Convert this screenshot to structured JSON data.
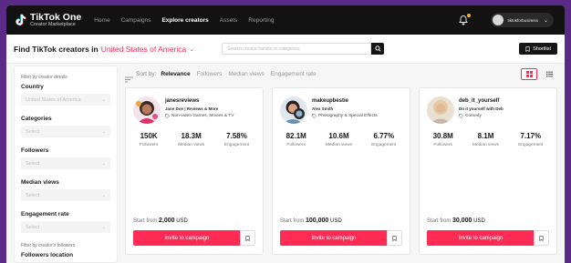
{
  "nav": {
    "brand_title": "TikTok One",
    "brand_subtitle": "Creator Marketplace",
    "items": [
      {
        "label": "Home",
        "active": false
      },
      {
        "label": "Campaigns",
        "active": false
      },
      {
        "label": "Explore creators",
        "active": true
      },
      {
        "label": "Assets",
        "active": false
      },
      {
        "label": "Reporting",
        "active": false
      }
    ],
    "account_name": "tiktokforbusiness"
  },
  "header": {
    "title": "Find TikTok creators in",
    "country": "United States of America",
    "search_placeholder": "Search creator handle or categories",
    "shortlist_label": "Shortlist"
  },
  "filters": {
    "heading": "Filter by creator details",
    "groups": [
      {
        "label": "Country",
        "value": "United States of America"
      },
      {
        "label": "Categories",
        "value": "Select"
      },
      {
        "label": "Followers",
        "value": "Select"
      },
      {
        "label": "Median views",
        "value": "Select"
      },
      {
        "label": "Engagement rate",
        "value": "Select"
      }
    ],
    "followers_heading": "Filter by creator's followers",
    "followers_location": "Followers location"
  },
  "sort": {
    "label": "Sort by:",
    "options": [
      {
        "label": "Relevance",
        "active": true
      },
      {
        "label": "Followers",
        "active": false
      },
      {
        "label": "Median views",
        "active": false
      },
      {
        "label": "Engagement rate",
        "active": false
      }
    ]
  },
  "creators": [
    {
      "handle": "janesreviews",
      "name": "Jane Doe | Reviews & More",
      "category": "Non-video Games, Movies & TV",
      "followers": "150K",
      "median_views": "18.3M",
      "engagement": "7.58%",
      "price": "2,000",
      "currency": "USD"
    },
    {
      "handle": "makeupbestie",
      "name": "Alex Smith",
      "category": "Photography & Special Effects",
      "followers": "82.1M",
      "median_views": "10.6M",
      "engagement": "6.77%",
      "price": "100,000",
      "currency": "USD"
    },
    {
      "handle": "deb_it_yourself",
      "name": "Do it yourself with Deb",
      "category": "Comedy",
      "followers": "30.8M",
      "median_views": "8.1M",
      "engagement": "7.17%",
      "price": "30,000",
      "currency": "USD"
    }
  ],
  "labels": {
    "followers": "Followers",
    "median_views": "Median views",
    "engagement": "Engagement",
    "start_from": "Start from",
    "invite": "Invite to campaign"
  },
  "colors": {
    "accent": "#fe2c55",
    "nav_bg": "#121212",
    "outer_bg": "#5b2a86"
  }
}
